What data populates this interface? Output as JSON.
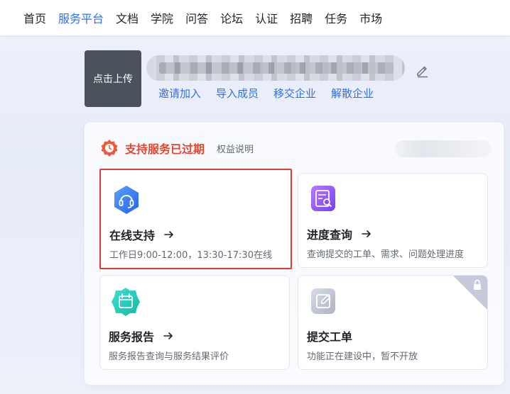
{
  "nav": {
    "items": [
      "首页",
      "服务平台",
      "文档",
      "学院",
      "问答",
      "论坛",
      "认证",
      "招聘",
      "任务",
      "市场"
    ],
    "active_index": 1
  },
  "company": {
    "avatar_label": "点击上传",
    "actions": [
      "邀请加入",
      "导入成员",
      "移交企业",
      "解散企业"
    ]
  },
  "support": {
    "status": "支持服务已过期",
    "rights_link": "权益说明",
    "status_color": "#e8432d"
  },
  "cards": {
    "online": {
      "title": "在线支持",
      "desc": "工作日9:00-12:00，13:30-17:30在线",
      "icon": "headset-icon"
    },
    "progress": {
      "title": "进度查询",
      "desc": "查询提交的工单、需求、问题处理进度",
      "icon": "document-search-icon"
    },
    "report": {
      "title": "服务报告",
      "desc": "服务报告查询与服务结果评价",
      "icon": "calendar-report-icon"
    },
    "ticket": {
      "title": "提交工单",
      "desc": "功能正在建设中，暂不开放",
      "icon": "edit-icon",
      "locked": true
    }
  },
  "colors": {
    "accent": "#2f6fed",
    "highlight_border": "#e53935"
  }
}
